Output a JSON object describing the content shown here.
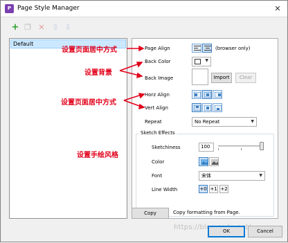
{
  "window": {
    "title": "Page Style Manager",
    "close_glyph": "✕",
    "app_icon_glyph": "P"
  },
  "toolbar": {
    "add_icon": "add-icon",
    "copy_icon": "copy-icon",
    "delete_icon": "delete-icon",
    "up_icon": "arrow-up-icon",
    "down_icon": "arrow-down-icon"
  },
  "style_list": {
    "items": [
      "Default"
    ]
  },
  "properties": {
    "page_align": {
      "label": "Page Align",
      "note": "(browser only)"
    },
    "back_color": {
      "label": "Back Color"
    },
    "back_image": {
      "label": "Back Image",
      "import_label": "Import",
      "clear_label": "Clear"
    },
    "horz_align": {
      "label": "Horz Align"
    },
    "vert_align": {
      "label": "Vert Align"
    },
    "repeat": {
      "label": "Repeat",
      "value": "No Repeat"
    },
    "sketch_effects": {
      "group_title": "Sketch Effects",
      "sketchiness_label": "Sketchiness",
      "sketchiness_value": "100",
      "color_label": "Color",
      "font_label": "Font",
      "font_value": "宋体",
      "line_width_label": "Line Width",
      "line_width_options": [
        "+0",
        "+1",
        "+2"
      ]
    }
  },
  "copy": {
    "button_label": "Copy",
    "description": "Copy formatting from Page."
  },
  "dialog_buttons": {
    "ok": "OK",
    "cancel": "Cancel"
  },
  "annotations": {
    "center_page": "设置页面居中方式",
    "background": "设置背景",
    "center_align": "设置页面居中方式",
    "sketch_style": "设置手绘风格"
  },
  "watermark": "https://blog.csdn.net/...",
  "colors": {
    "annotation_red": "#e2001a",
    "selection_blue": "#cce8ff",
    "accent_blue": "#0078d7"
  }
}
